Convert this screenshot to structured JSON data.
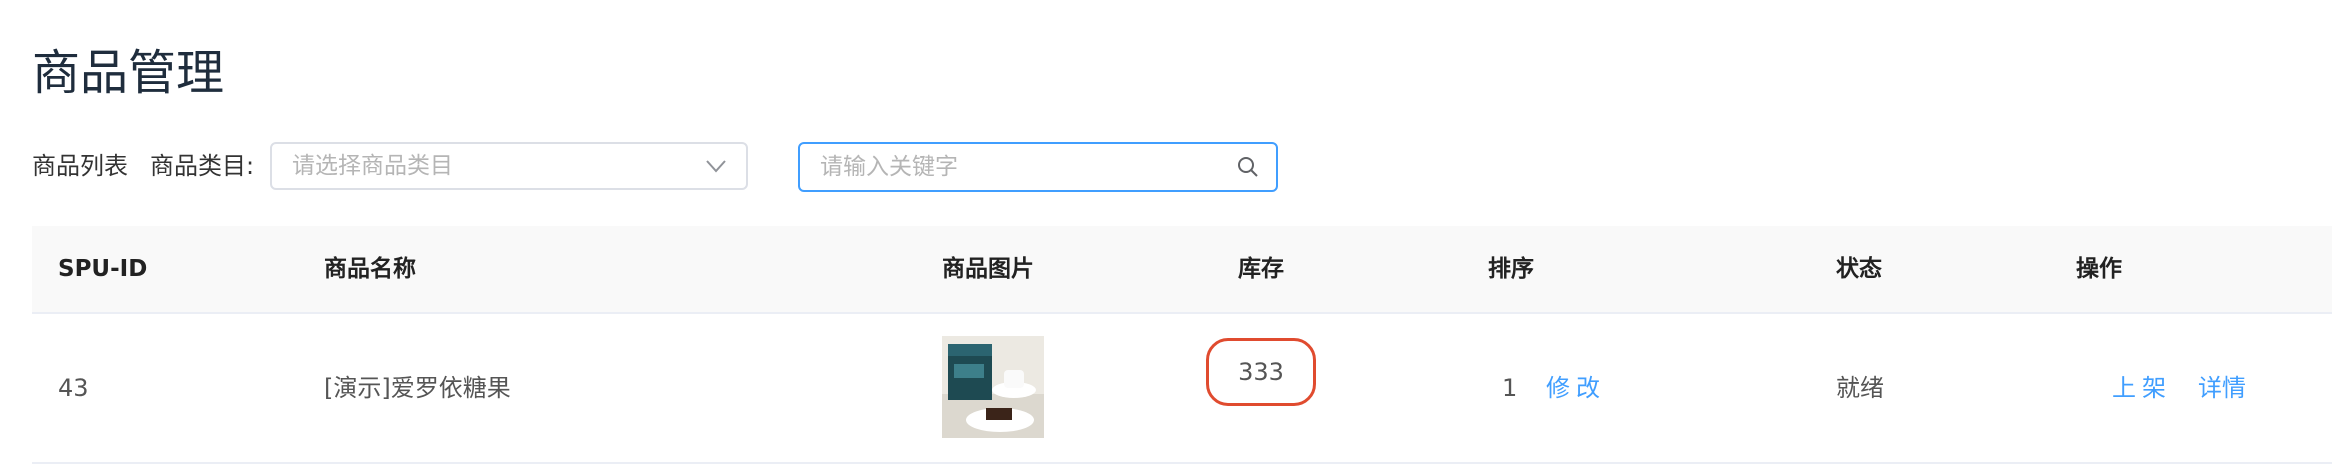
{
  "page": {
    "title": "商品管理"
  },
  "filters": {
    "list_label": "商品列表",
    "category_label": "商品类目:",
    "category_placeholder": "请选择商品类目",
    "search_placeholder": "请输入关键字"
  },
  "table": {
    "columns": [
      "SPU-ID",
      "商品名称",
      "商品图片",
      "库存",
      "排序",
      "状态",
      "操作"
    ],
    "rows": [
      {
        "spu_id": "43",
        "name": "[演示]爱罗依糖果",
        "stock": "333",
        "sort": "1",
        "edit_label": "修改",
        "status": "就绪",
        "action_shelf": "上架",
        "action_detail": "详情"
      }
    ]
  },
  "colors": {
    "accent": "#409eff",
    "highlight": "#e04b2f",
    "title": "#1f2d3d"
  },
  "icons": {
    "category_select": "chevron-down-icon",
    "search": "search-icon"
  }
}
